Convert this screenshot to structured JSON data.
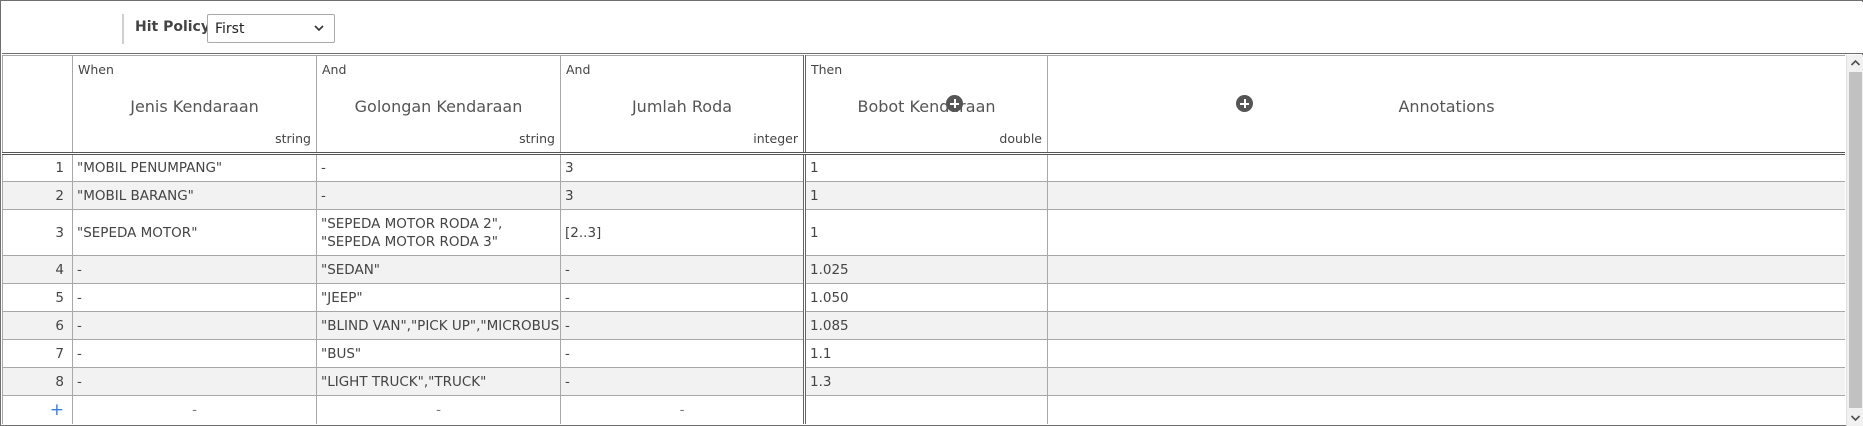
{
  "toolbar": {
    "hit_policy_label": "Hit Policy:",
    "hit_policy_value": "First"
  },
  "columns": [
    {
      "kind": "When",
      "name": "Jenis Kendaraan",
      "type": "string"
    },
    {
      "kind": "And",
      "name": "Golongan Kendaraan",
      "type": "string"
    },
    {
      "kind": "And",
      "name": "Jumlah Roda",
      "type": "integer"
    },
    {
      "kind": "Then",
      "name": "Bobot Kendaraan",
      "type": "double"
    },
    {
      "kind": "",
      "name": "Annotations",
      "type": ""
    }
  ],
  "rows": [
    {
      "n": "1",
      "c1": "\"MOBIL PENUMPANG\"",
      "c2": "-",
      "c3": "3",
      "c4": "1",
      "c5": ""
    },
    {
      "n": "2",
      "c1": "\"MOBIL BARANG\"",
      "c2": "-",
      "c3": "3",
      "c4": "1",
      "c5": ""
    },
    {
      "n": "3",
      "c1": "\"SEPEDA MOTOR\"",
      "c2": "\"SEPEDA MOTOR RODA 2\", \"SEPEDA MOTOR RODA 3\"",
      "c3": "[2..3]",
      "c4": "1",
      "c5": ""
    },
    {
      "n": "4",
      "c1": "-",
      "c2": "\"SEDAN\"",
      "c3": "-",
      "c4": "1.025",
      "c5": ""
    },
    {
      "n": "5",
      "c1": "-",
      "c2": "\"JEEP\"",
      "c3": "-",
      "c4": "1.050",
      "c5": ""
    },
    {
      "n": "6",
      "c1": "-",
      "c2": "\"BLIND VAN\",\"PICK UP\",\"MICROBUS\"",
      "c3": "-",
      "c4": "1.085",
      "c5": ""
    },
    {
      "n": "7",
      "c1": "-",
      "c2": "\"BUS\"",
      "c3": "-",
      "c4": "1.1",
      "c5": ""
    },
    {
      "n": "8",
      "c1": "-",
      "c2": "\"LIGHT TRUCK\",\"TRUCK\"",
      "c3": "-",
      "c4": "1.3",
      "c5": ""
    }
  ],
  "add_row": {
    "plus": "+",
    "d1": "-",
    "d2": "-",
    "d3": "-"
  },
  "icons": {
    "chevron": "chevron-down-icon",
    "add_column": "add-column-icon",
    "scroll_up": "scroll-up-icon",
    "scroll_down": "scroll-down-icon"
  }
}
